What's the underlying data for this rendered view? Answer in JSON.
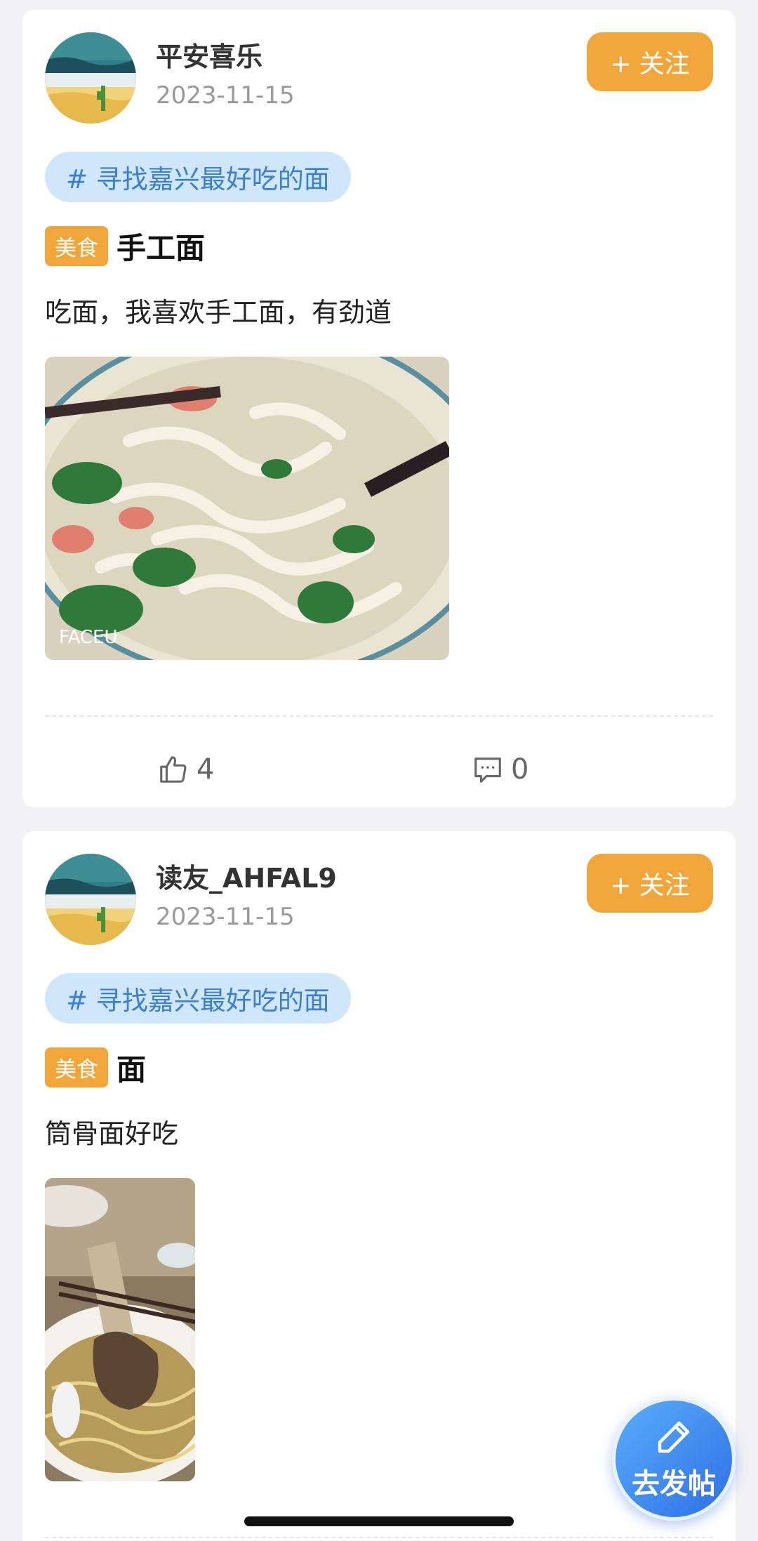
{
  "posts": [
    {
      "username": "平安喜乐",
      "date": "2023-11-15",
      "follow_label": "+ 关注",
      "topic": "# 寻找嘉兴最好吃的面",
      "category": "美食",
      "title": "手工面",
      "body": "吃面，我喜欢手工面，有劲道",
      "photo_watermark": "FACEU",
      "likes": "4",
      "comments": "0"
    },
    {
      "username": "读友_AHFAL9",
      "date": "2023-11-15",
      "follow_label": "+ 关注",
      "topic": "# 寻找嘉兴最好吃的面",
      "category": "美食",
      "title": "面",
      "body": "筒骨面好吃"
    }
  ],
  "fab": {
    "label": "去发帖",
    "icon": "pencil-icon"
  },
  "colors": {
    "accent_orange": "#f0a63a",
    "topic_blue": "#3a7fd0",
    "fab_blue": "#3a86ee"
  }
}
